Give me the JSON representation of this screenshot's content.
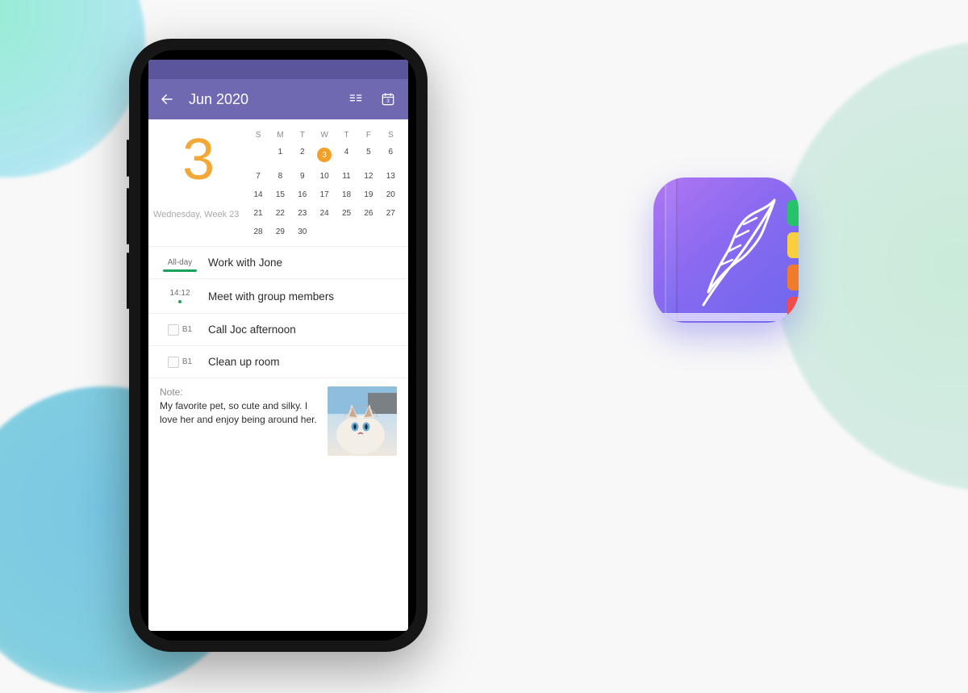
{
  "header": {
    "title": "Jun 2020"
  },
  "calendar": {
    "big_date": "3",
    "subline": "Wednesday, Week 23",
    "dow": [
      "S",
      "M",
      "T",
      "W",
      "T",
      "F",
      "S"
    ],
    "selected_day": 3,
    "weeks": [
      [
        "",
        "1",
        "2",
        "3",
        "4",
        "5",
        "6"
      ],
      [
        "7",
        "8",
        "9",
        "10",
        "11",
        "12",
        "13"
      ],
      [
        "14",
        "15",
        "16",
        "17",
        "18",
        "19",
        "20"
      ],
      [
        "21",
        "22",
        "23",
        "24",
        "25",
        "26",
        "27"
      ],
      [
        "28",
        "29",
        "30",
        "",
        "",
        "",
        ""
      ]
    ]
  },
  "events": [
    {
      "slot_type": "allday",
      "slot_label": "All-day",
      "title": "Work with Jone"
    },
    {
      "slot_type": "time",
      "slot_label": "14:12",
      "title": "Meet with group members"
    },
    {
      "slot_type": "todo",
      "priority": "B1",
      "title": "Call Joc afternoon"
    },
    {
      "slot_type": "todo",
      "priority": "B1",
      "title": "Clean up room"
    }
  ],
  "note": {
    "label": "Note:",
    "body": "My favorite pet, so cute and silky. I love her and enjoy being around her.",
    "image_alt": "cat-photo"
  }
}
